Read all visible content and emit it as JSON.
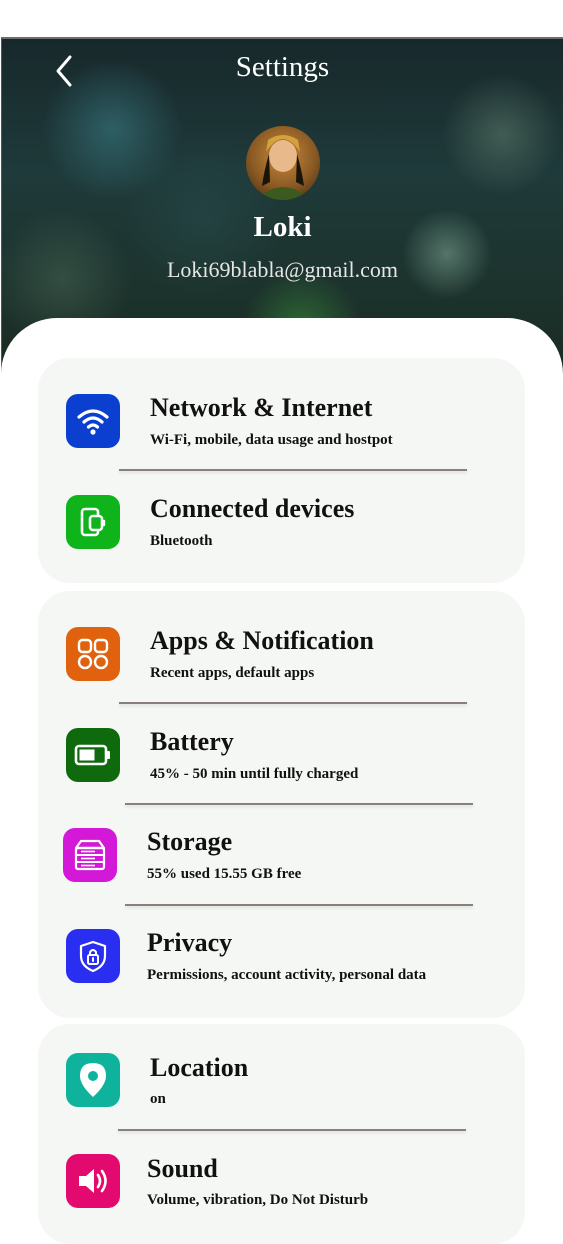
{
  "header": {
    "title": "Settings",
    "name": "Loki",
    "email": "Loki69blabla@gmail.com"
  },
  "groups": [
    {
      "items": [
        {
          "title": "Network & Internet",
          "subtitle": "Wi-Fi, mobile, data usage and hostpot",
          "icon": "wifi-icon",
          "color": "#0a3fcf"
        },
        {
          "title": "Connected devices",
          "subtitle": "Bluetooth",
          "icon": "connected-devices-icon",
          "color": "#0fb31a"
        }
      ]
    },
    {
      "items": [
        {
          "title": "Apps & Notification",
          "subtitle": "Recent apps, default apps",
          "icon": "apps-grid-icon",
          "color": "#e1620e"
        },
        {
          "title": "Battery",
          "subtitle": "45% - 50 min until fully charged",
          "icon": "battery-icon",
          "color": "#0f6a0e"
        },
        {
          "title": "Storage",
          "subtitle": "55% used 15.55 GB free",
          "icon": "storage-icon",
          "color": "#d318d8"
        },
        {
          "title": "Privacy",
          "subtitle": "Permissions, account activity, personal data",
          "icon": "privacy-shield-icon",
          "color": "#2a2ef0"
        }
      ]
    },
    {
      "items": [
        {
          "title": "Location",
          "subtitle": "on",
          "icon": "location-pin-icon",
          "color": "#0fb39b"
        },
        {
          "title": "Sound",
          "subtitle": "Volume, vibration, Do Not Disturb",
          "icon": "speaker-icon",
          "color": "#e20a6e"
        }
      ]
    }
  ]
}
